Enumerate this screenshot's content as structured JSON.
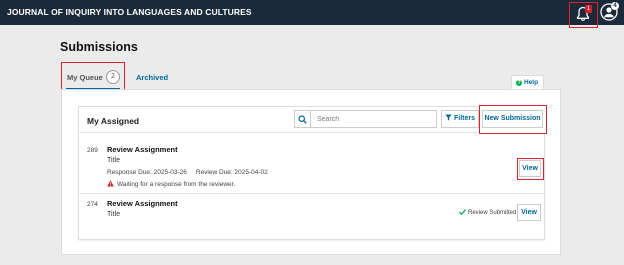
{
  "header": {
    "site_title": "JOURNAL OF INQUIRY INTO LANGUAGES AND CULTURES",
    "notification_count": "1",
    "user_badge": "4"
  },
  "page": {
    "title": "Submissions"
  },
  "tabs": [
    {
      "label": "My Queue",
      "count": "2",
      "active": true
    },
    {
      "label": "Archived",
      "active": false
    }
  ],
  "help": {
    "label": "Help"
  },
  "list": {
    "title": "My Assigned",
    "search_placeholder": "Search",
    "filters_label": "Filters",
    "new_submission_label": "New Submission",
    "items": [
      {
        "id": "289",
        "heading": "Review Assignment",
        "subtitle": "Title",
        "response_due": "Response Due: 2025-03-26",
        "review_due": "Review Due: 2025-04-02",
        "warning": "Waiting for a response from the reviewer.",
        "action": "View"
      },
      {
        "id": "274",
        "heading": "Review Assignment",
        "subtitle": "Title",
        "status": "Review Submitted",
        "action": "View"
      }
    ]
  },
  "colors": {
    "topbar": "#1b2a3a",
    "link": "#006798",
    "highlight": "#e0202a",
    "warning": "#d0202a",
    "success": "#00b24e"
  }
}
